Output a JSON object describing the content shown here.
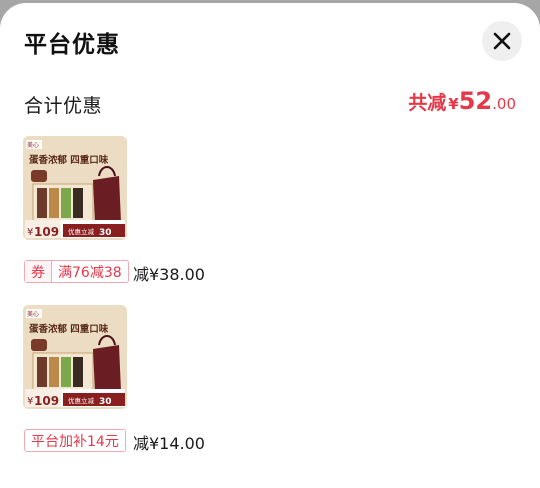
{
  "sheet": {
    "title": "平台优惠",
    "close_icon": "close-icon"
  },
  "summary": {
    "label": "合计优惠",
    "prefix": "共减",
    "currency": "¥",
    "amount_int": "52",
    "amount_dec": ".00"
  },
  "items": [
    {
      "product": {
        "brand": "美心",
        "headline": "蛋香浓郁 四重口味",
        "price": "109",
        "badge": "优惠立减",
        "badge_amount": "30"
      },
      "coupon_type": "券",
      "coupon_rule": "满76减38",
      "discount": "减¥38.00"
    },
    {
      "product": {
        "brand": "美心",
        "headline": "蛋香浓郁 四重口味",
        "price": "109",
        "badge": "优惠立减",
        "badge_amount": "30"
      },
      "coupon_type": "平台加补14元",
      "discount": "减¥14.00"
    }
  ],
  "colors": {
    "accent": "#e5394a",
    "tag_border": "#f1a9b2",
    "overlay": "#a6a6a6"
  }
}
